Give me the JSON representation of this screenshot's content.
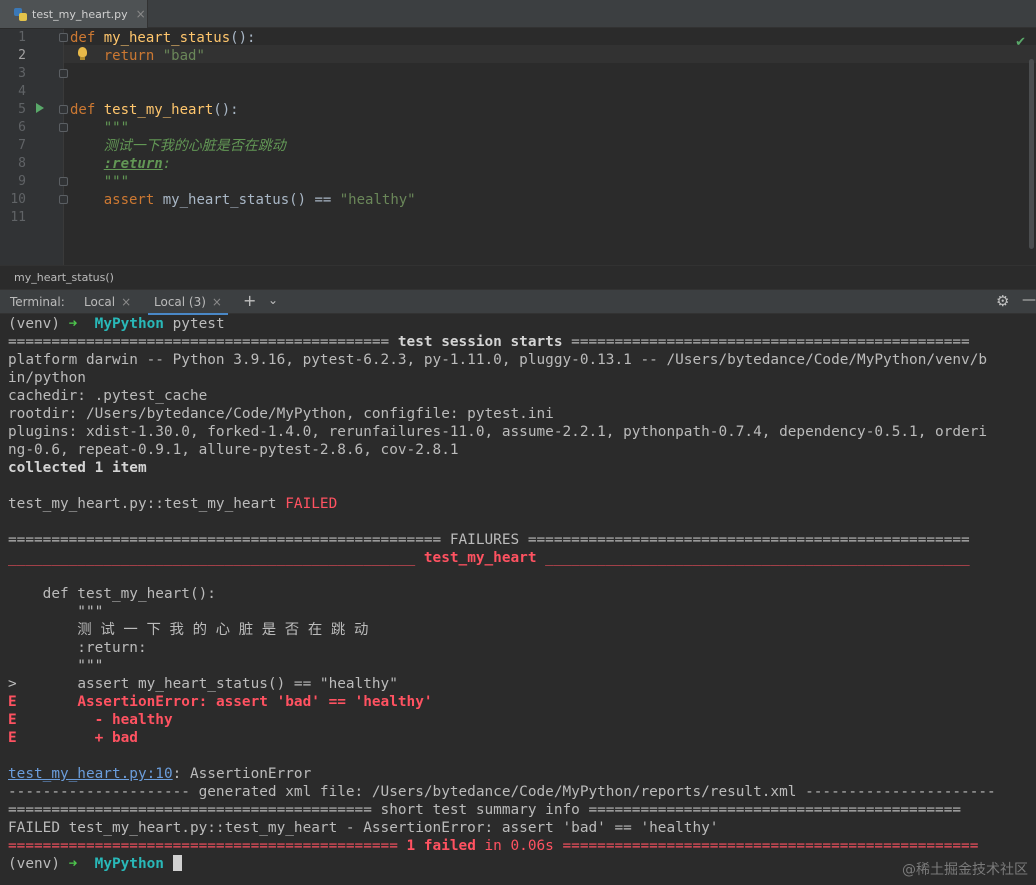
{
  "editor_tab": {
    "filename": "test_my_heart.py"
  },
  "editor": {
    "line_numbers": [
      "1",
      "2",
      "3",
      "4",
      "5",
      "6",
      "7",
      "8",
      "9",
      "10",
      "11"
    ],
    "l1": {
      "kw": "def ",
      "fn": "my_heart_status",
      "rest": "():"
    },
    "l2": {
      "indent": "    ",
      "kw": "return ",
      "str": "\"bad\""
    },
    "l5": {
      "kw": "def ",
      "fn": "test_my_heart",
      "rest": "():"
    },
    "l6": "    \"\"\"",
    "l7": "    测试一下我的心脏是否在跳动",
    "l8": {
      "indent": "    ",
      "tag": ":return",
      "colon": ":"
    },
    "l9": "    \"\"\"",
    "l10": {
      "indent": "    ",
      "kw": "assert ",
      "mid": "my_heart_status() == ",
      "str": "\"healthy\""
    }
  },
  "breadcrumb": "my_heart_status()",
  "terminal_bar": {
    "label": "Terminal:",
    "tabs": [
      "Local",
      "Local (3)"
    ],
    "active_tab": "Local (3)"
  },
  "terminal": {
    "venv": "(venv) ",
    "arrow": "➜  ",
    "dir": "MyPython",
    "cmd": " pytest",
    "session_sep_left": "============================================",
    "session_title": " test session starts ",
    "session_sep_right": "==============================================",
    "platform": "platform darwin -- Python 3.9.16, pytest-6.2.3, py-1.11.0, pluggy-0.13.1 -- /Users/bytedance/Code/MyPython/venv/b",
    "platform2": "in/python",
    "cachedir": "cachedir: .pytest_cache",
    "rootdir": "rootdir: /Users/bytedance/Code/MyPython, configfile: pytest.ini",
    "plugins": "plugins: xdist-1.30.0, forked-1.4.0, rerunfailures-11.0, assume-2.2.1, pythonpath-0.7.4, dependency-0.5.1, orderi",
    "plugins2": "ng-0.6, repeat-0.9.1, allure-pytest-2.8.6, cov-2.8.1",
    "collected": "collected 1 item",
    "result_test": "test_my_heart.py::test_my_heart ",
    "result_status": "FAILED",
    "failures_left": "================================================== ",
    "failures_title": "FAILURES",
    "failures_right": " ===================================================",
    "fail_test_left": "_______________________________________________ ",
    "fail_test_title": "test_my_heart",
    "fail_test_right": " _________________________________________________",
    "src1": "    def test_my_heart():",
    "src2": "        \"\"\"",
    "src3": "        测 试 一 下 我 的 心 脏 是 否 在 跳 动",
    "src4": "        :return:",
    "src5": "        \"\"\"",
    "src6_marker": ">",
    "src6": "       assert my_heart_status() == \"healthy\"",
    "e_marker": "E",
    "e1": "       AssertionError: assert 'bad' == 'healthy'",
    "e2": "         - healthy",
    "e3": "         + bad",
    "loc_link": "test_my_heart.py:10",
    "loc_rest": ": AssertionError",
    "xml": "--------------------- generated xml file: /Users/bytedance/Code/MyPython/reports/result.xml ----------------------",
    "summary": "========================================== short test summary info ===========================================",
    "failed_line": "FAILED test_my_heart.py::test_my_heart - AssertionError: assert 'bad' == 'healthy'",
    "final_left": "============================================= ",
    "final_failed": "1 failed",
    "final_mid": " in 0.06s",
    "final_right": " ================================================"
  },
  "watermark": "@稀土掘金技术社区"
}
